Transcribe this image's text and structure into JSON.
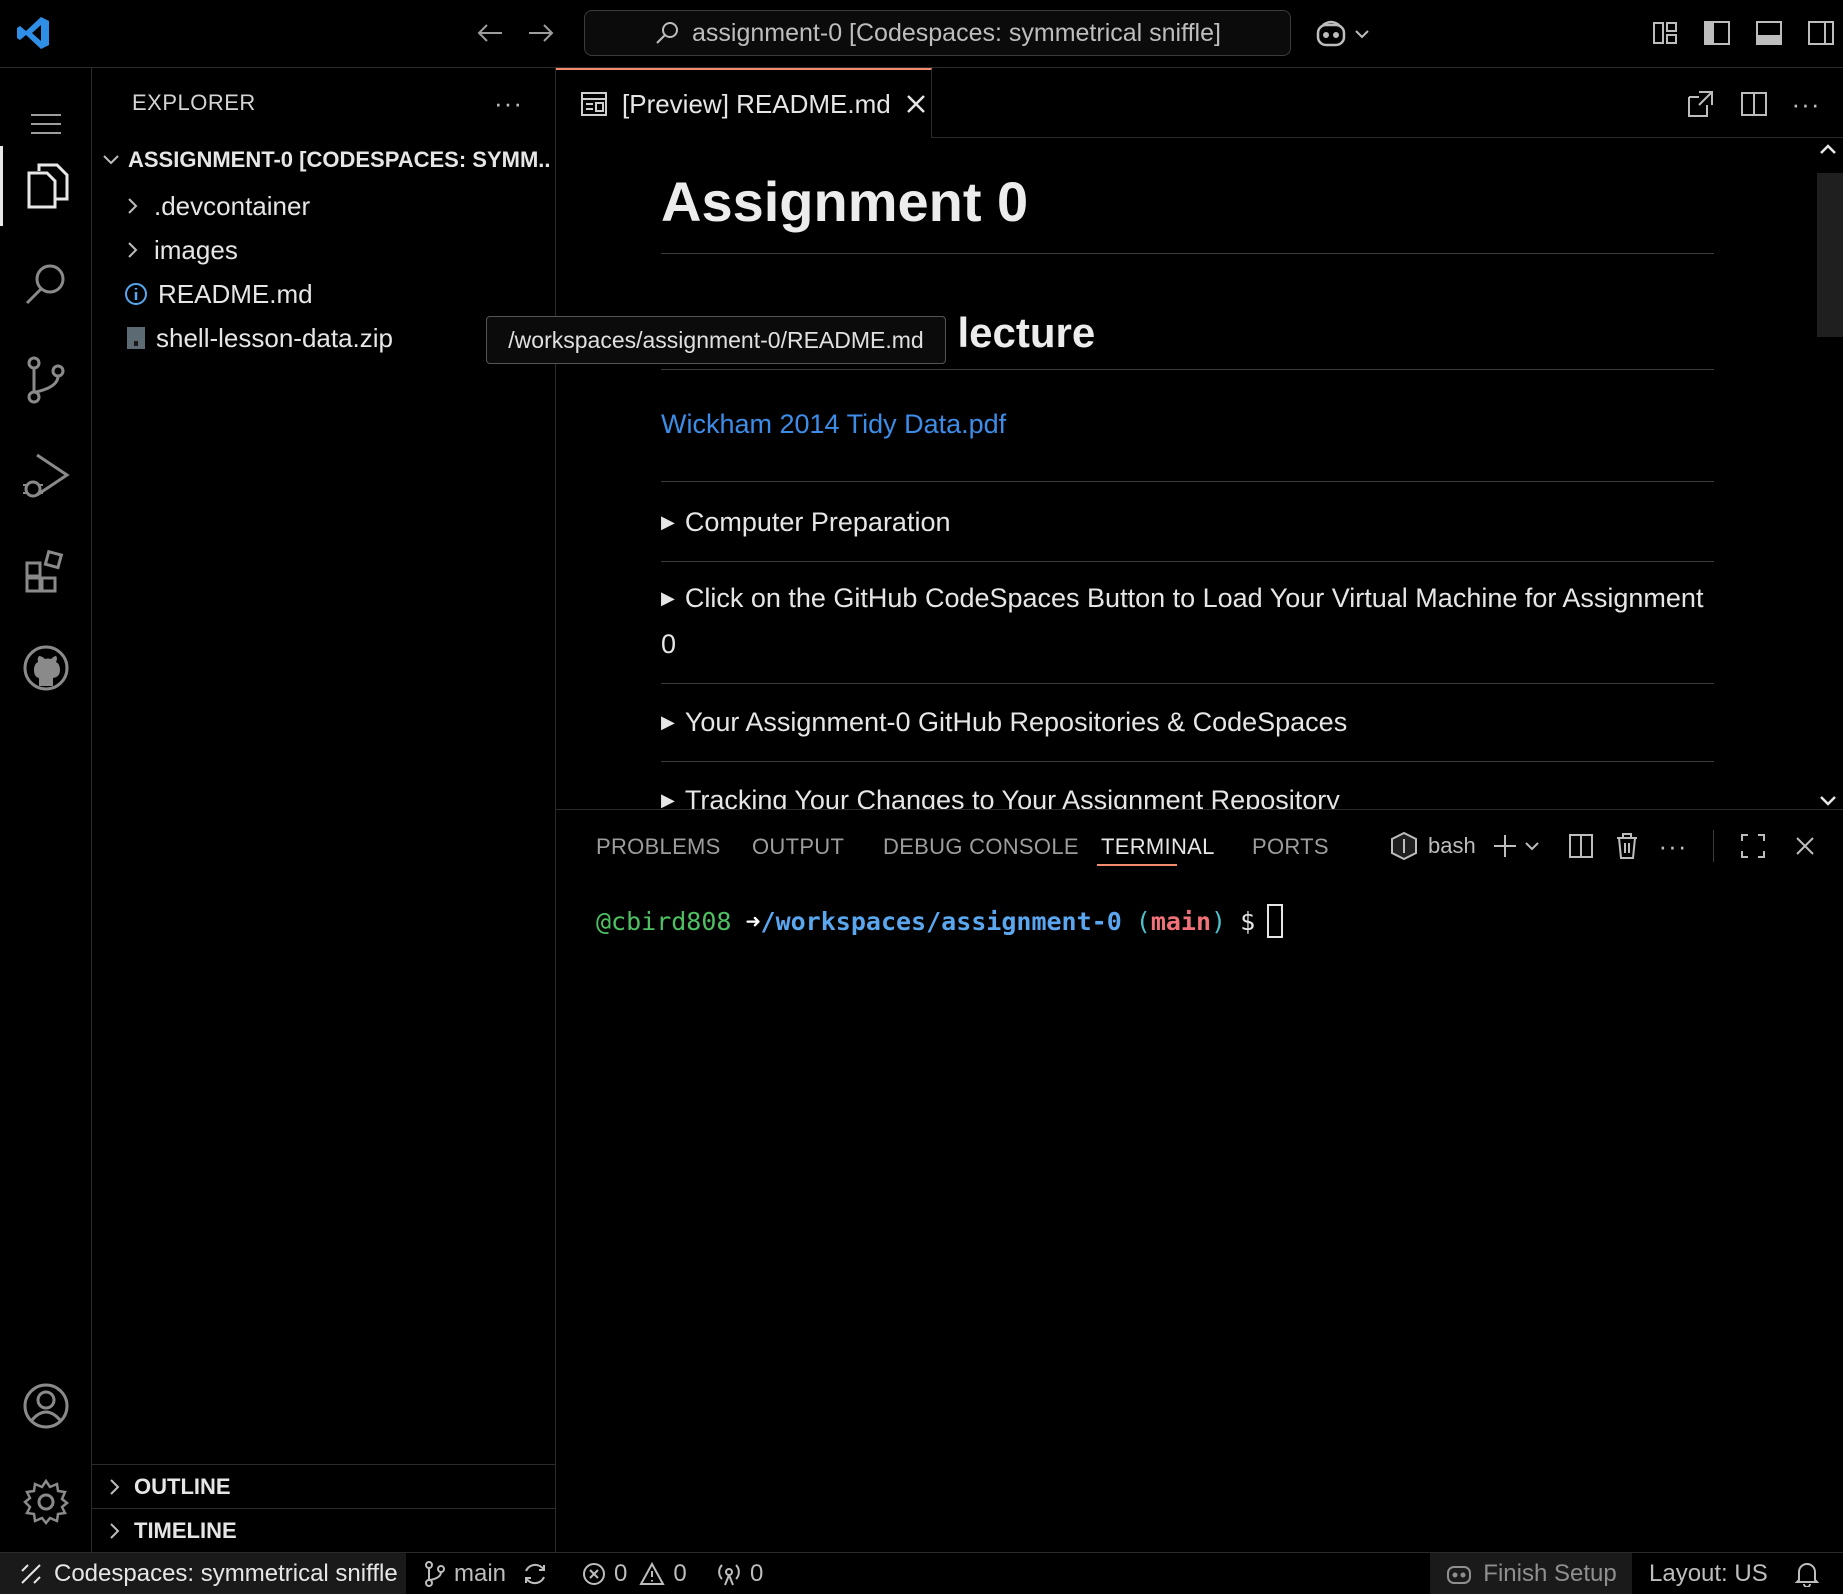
{
  "titlebar": {
    "command_center": "assignment-0 [Codespaces: symmetrical sniffle]"
  },
  "sidebar": {
    "title": "EXPLORER",
    "more": "···",
    "folder": "ASSIGNMENT-0 [CODESPACES: SYMM...",
    "items": [
      {
        "label": ".devcontainer",
        "kind": "folder"
      },
      {
        "label": "images",
        "kind": "folder"
      },
      {
        "label": "README.md",
        "kind": "info-file"
      },
      {
        "label": "shell-lesson-data.zip",
        "kind": "zip-file"
      }
    ],
    "outline": "OUTLINE",
    "timeline": "TIMELINE"
  },
  "tooltip": "/workspaces/assignment-0/README.md",
  "editor": {
    "tab_label": "[Preview] README.md",
    "h1": "Assignment 0",
    "h2": "scussion Next lecture",
    "link": "Wickham 2014 Tidy Data.pdf",
    "details": [
      "Computer Preparation",
      "Click on the GitHub CodeSpaces Button to Load Your Virtual Machine for Assignment 0",
      "Your Assignment-0 GitHub Repositories & CodeSpaces",
      "Tracking Your Changes to Your Assignment Repository"
    ]
  },
  "panel": {
    "tabs": [
      "PROBLEMS",
      "OUTPUT",
      "DEBUG CONSOLE",
      "TERMINAL",
      "PORTS"
    ],
    "active_tab": "TERMINAL",
    "shell": "bash",
    "prompt": {
      "user": "@cbird808",
      "arrow": "➜",
      "path": "/workspaces/assignment-0",
      "branch_open": "(",
      "branch": "main",
      "branch_close": ")",
      "dollar": "$"
    }
  },
  "statusbar": {
    "remote": "Codespaces: symmetrical sniffle",
    "branch": "main",
    "errors": "0",
    "warnings": "0",
    "ports": "0",
    "finish_setup": "Finish Setup",
    "layout": "Layout: US"
  },
  "colors": {
    "accent": "#f38b6e",
    "link": "#3d8de8",
    "prompt_user": "#4ec063",
    "prompt_path": "#5aa7f0",
    "prompt_branch": "#f07178",
    "prompt_paren": "#4ec0c9"
  }
}
